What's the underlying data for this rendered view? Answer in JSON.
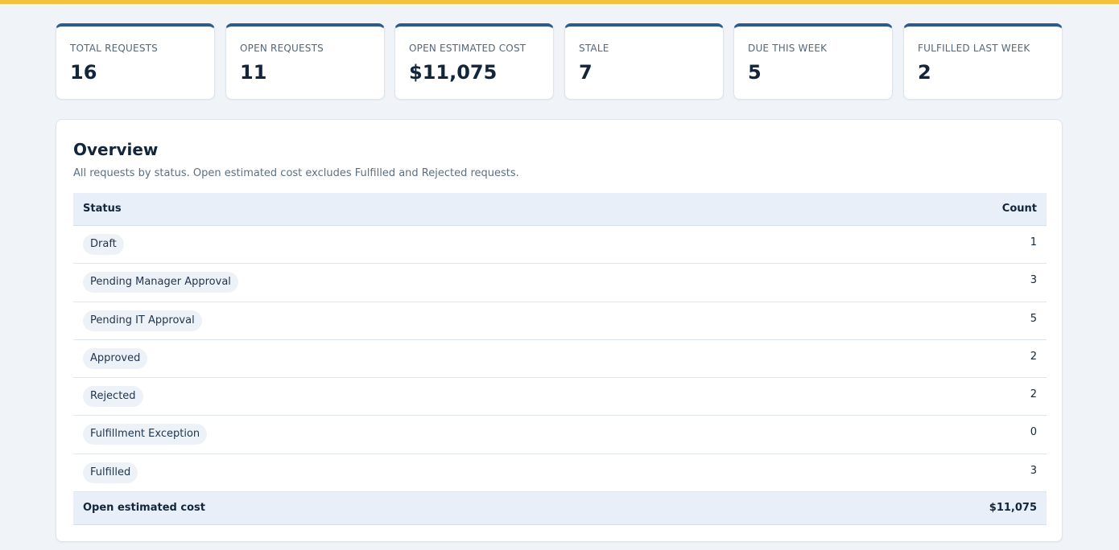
{
  "stats": [
    {
      "label": "TOTAL REQUESTS",
      "value": "16"
    },
    {
      "label": "OPEN REQUESTS",
      "value": "11"
    },
    {
      "label": "OPEN ESTIMATED COST",
      "value": "$11,075"
    },
    {
      "label": "STALE",
      "value": "7"
    },
    {
      "label": "DUE THIS WEEK",
      "value": "5"
    },
    {
      "label": "FULFILLED LAST WEEK",
      "value": "2"
    }
  ],
  "overview": {
    "title": "Overview",
    "description": "All requests by status. Open estimated cost excludes Fulfilled and Rejected requests.",
    "columns": {
      "status": "Status",
      "count": "Count"
    },
    "rows": [
      {
        "status": "Draft",
        "count": "1"
      },
      {
        "status": "Pending Manager Approval",
        "count": "3"
      },
      {
        "status": "Pending IT Approval",
        "count": "5"
      },
      {
        "status": "Approved",
        "count": "2"
      },
      {
        "status": "Rejected",
        "count": "2"
      },
      {
        "status": "Fulfillment Exception",
        "count": "0"
      },
      {
        "status": "Fulfilled",
        "count": "3"
      }
    ],
    "footer": {
      "label": "Open estimated cost",
      "value": "$11,075"
    }
  },
  "colors": {
    "accent_bar": "#f4c13d",
    "card_top_border": "#2c5a8a",
    "page_background": "#f0f4f8",
    "table_header_background": "#e8eff8",
    "pill_background": "#edf2f8"
  }
}
